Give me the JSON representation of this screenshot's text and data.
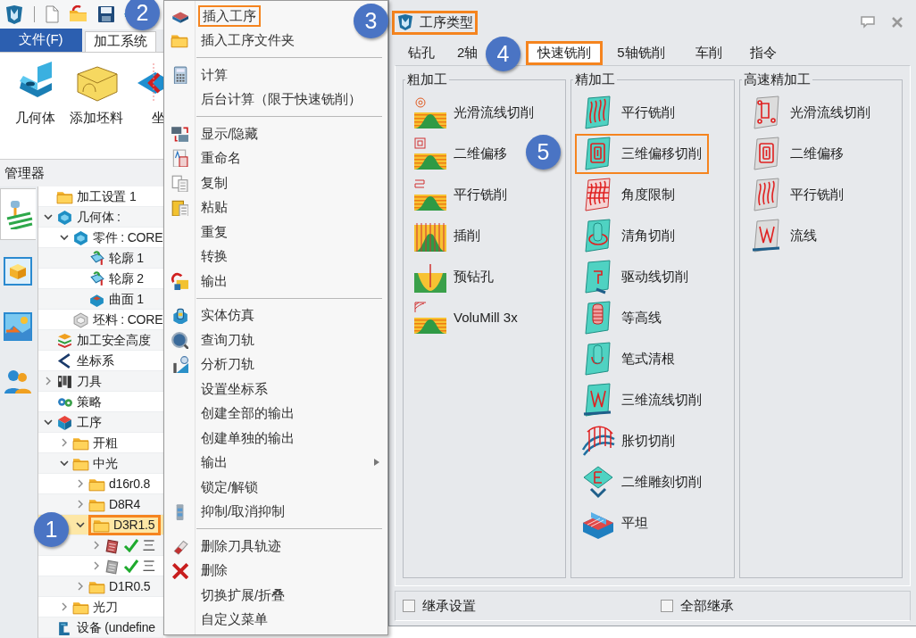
{
  "ribbon": {
    "file_menu": "文件(F)",
    "tabs": [
      {
        "label": "加工系统",
        "selected": true
      }
    ],
    "buttons": [
      {
        "label": "几何体"
      },
      {
        "label": "添加坯料"
      },
      {
        "label": "坐"
      }
    ]
  },
  "manager": {
    "title": "管理器",
    "side_tabs": [
      {
        "selected": true
      },
      {
        "selected": false
      },
      {
        "selected": false
      },
      {
        "selected": false
      }
    ],
    "tree": [
      {
        "label": "加工设置 1",
        "kind": "folder",
        "selected": false,
        "highlighted": false
      },
      {
        "label": "几何体 :",
        "kind": "geometry",
        "expanded": true,
        "selected": false,
        "highlighted": false,
        "children": [
          {
            "label": "零件 : CORE",
            "kind": "geometry",
            "expanded": true,
            "selected": false,
            "highlighted": false,
            "children": [
              {
                "label": "轮廓 1",
                "kind": "profile",
                "selected": false,
                "highlighted": false
              },
              {
                "label": "轮廓 2",
                "kind": "profile",
                "selected": false,
                "highlighted": false
              },
              {
                "label": "曲面 1",
                "kind": "surface",
                "selected": false,
                "highlighted": false
              }
            ]
          },
          {
            "label": "坯料 : CORE",
            "kind": "stock",
            "selected": false,
            "highlighted": false
          }
        ]
      },
      {
        "label": "加工安全高度",
        "kind": "layers",
        "selected": false,
        "highlighted": false
      },
      {
        "label": "坐标系",
        "kind": "axes",
        "selected": false,
        "highlighted": false
      },
      {
        "label": "刀具",
        "kind": "tools",
        "expanded": false,
        "selected": false,
        "highlighted": false
      },
      {
        "label": "策略",
        "kind": "gears",
        "selected": false,
        "highlighted": false
      },
      {
        "label": "工序",
        "kind": "cube",
        "expanded": true,
        "selected": false,
        "highlighted": false,
        "children": [
          {
            "label": "开粗",
            "kind": "folder",
            "expanded": false,
            "selected": false,
            "highlighted": false
          },
          {
            "label": "中光",
            "kind": "folder",
            "expanded": true,
            "selected": false,
            "highlighted": false,
            "children": [
              {
                "label": "d16r0.8",
                "kind": "folder",
                "expanded": false,
                "selected": false,
                "highlighted": false
              },
              {
                "label": "D8R4",
                "kind": "folder",
                "expanded": false,
                "selected": false,
                "highlighted": false
              },
              {
                "label": "D3R1.5",
                "kind": "folder",
                "expanded": true,
                "selected": true,
                "highlighted": true,
                "children": [
                  {
                    "label": "三",
                    "kind": "toolpath",
                    "expanded": false,
                    "selected": false,
                    "highlighted": false,
                    "verified": true
                  },
                  {
                    "label": "三",
                    "kind": "toolpath-idle",
                    "expanded": false,
                    "selected": false,
                    "highlighted": false,
                    "verified": true
                  }
                ]
              },
              {
                "label": "D1R0.5",
                "kind": "folder",
                "expanded": false,
                "selected": false,
                "highlighted": false
              }
            ]
          },
          {
            "label": "光刀",
            "kind": "folder",
            "expanded": false,
            "selected": false,
            "highlighted": false
          }
        ]
      },
      {
        "label": "设备 (undefine",
        "kind": "machine",
        "selected": false,
        "highlighted": false
      }
    ]
  },
  "context_menu": {
    "items": [
      {
        "kind": "item",
        "label": "插入工序",
        "highlighted": true
      },
      {
        "kind": "item",
        "label": "插入工序文件夹",
        "highlighted": false
      },
      {
        "kind": "separator"
      },
      {
        "kind": "item",
        "label": "计算",
        "highlighted": false
      },
      {
        "kind": "item",
        "label": "后台计算（限于快速铣削）",
        "highlighted": false
      },
      {
        "kind": "separator"
      },
      {
        "kind": "item",
        "label": "显示/隐藏",
        "highlighted": false
      },
      {
        "kind": "item",
        "label": "重命名",
        "highlighted": false
      },
      {
        "kind": "item",
        "label": "复制",
        "highlighted": false
      },
      {
        "kind": "item",
        "label": "粘贴",
        "highlighted": false
      },
      {
        "kind": "item",
        "label": "重复",
        "highlighted": false
      },
      {
        "kind": "item",
        "label": "转换",
        "highlighted": false
      },
      {
        "kind": "item",
        "label": "输出",
        "highlighted": false
      },
      {
        "kind": "separator"
      },
      {
        "kind": "item",
        "label": "实体仿真",
        "highlighted": false
      },
      {
        "kind": "item",
        "label": "查询刀轨",
        "highlighted": false
      },
      {
        "kind": "item",
        "label": "分析刀轨",
        "highlighted": false
      },
      {
        "kind": "item",
        "label": "设置坐标系",
        "highlighted": false
      },
      {
        "kind": "item",
        "label": "创建全部的输出",
        "highlighted": false
      },
      {
        "kind": "item",
        "label": "创建单独的输出",
        "highlighted": false
      },
      {
        "kind": "submenu",
        "label": "输出",
        "highlighted": false
      },
      {
        "kind": "item",
        "label": "锁定/解锁",
        "highlighted": false
      },
      {
        "kind": "item",
        "label": "抑制/取消抑制",
        "highlighted": false
      },
      {
        "kind": "separator"
      },
      {
        "kind": "item",
        "label": "删除刀具轨迹",
        "highlighted": false
      },
      {
        "kind": "item",
        "label": "删除",
        "highlighted": false
      },
      {
        "kind": "item",
        "label": "切换扩展/折叠",
        "highlighted": false
      },
      {
        "kind": "item",
        "label": "自定义菜单",
        "highlighted": false
      }
    ]
  },
  "dialog": {
    "title": "工序类型",
    "highlighted": true,
    "tabs": [
      {
        "label": "钻孔",
        "selected": false,
        "highlighted": false
      },
      {
        "label": "2轴",
        "selected": false,
        "highlighted": false
      },
      {
        "label": "快速铣削",
        "selected": true,
        "highlighted": true
      },
      {
        "label": "5轴铣削",
        "selected": false,
        "highlighted": false
      },
      {
        "label": "车削",
        "selected": false,
        "highlighted": false
      },
      {
        "label": "指令",
        "selected": false,
        "highlighted": false
      }
    ],
    "groups": [
      {
        "title": "粗加工",
        "items": [
          {
            "label": "光滑流线切削",
            "highlighted": false
          },
          {
            "label": "二维偏移",
            "highlighted": false
          },
          {
            "label": "平行铣削",
            "highlighted": false
          },
          {
            "label": "插削",
            "highlighted": false
          },
          {
            "label": "预钻孔",
            "highlighted": false
          },
          {
            "label": "VoluMill 3x",
            "highlighted": false
          }
        ]
      },
      {
        "title": "精加工",
        "items": [
          {
            "label": "平行铣削",
            "highlighted": false
          },
          {
            "label": "三维偏移切削",
            "highlighted": true
          },
          {
            "label": "角度限制",
            "highlighted": false
          },
          {
            "label": "清角切削",
            "highlighted": false
          },
          {
            "label": "驱动线切削",
            "highlighted": false
          },
          {
            "label": "等高线",
            "highlighted": false
          },
          {
            "label": "笔式清根",
            "highlighted": false
          },
          {
            "label": "三维流线切削",
            "highlighted": false
          },
          {
            "label": "胀切切削",
            "highlighted": false
          },
          {
            "label": "二维雕刻切削",
            "highlighted": false
          },
          {
            "label": "平坦",
            "highlighted": false
          }
        ]
      },
      {
        "title": "高速精加工",
        "items": [
          {
            "label": "光滑流线切削",
            "highlighted": false
          },
          {
            "label": "二维偏移",
            "highlighted": false
          },
          {
            "label": "平行铣削",
            "highlighted": false
          },
          {
            "label": "流线",
            "highlighted": false
          }
        ]
      }
    ],
    "options": [
      {
        "label": "继承设置",
        "checked": false
      },
      {
        "label": "全部继承",
        "checked": false
      }
    ]
  },
  "callouts": [
    {
      "number": "1"
    },
    {
      "number": "2"
    },
    {
      "number": "3"
    },
    {
      "number": "4"
    },
    {
      "number": "5"
    }
  ]
}
